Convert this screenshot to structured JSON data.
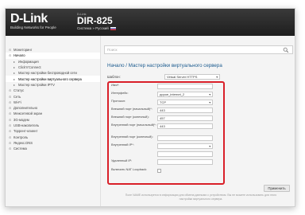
{
  "header": {
    "logo_main": "D-Link",
    "logo_sub": "Building Networks for People",
    "model_caption": "D-Link",
    "model_name": "DIR-825",
    "lang_text": "Система » Русский"
  },
  "sidebar": {
    "items": [
      {
        "label": "Мониторинг",
        "level": 0,
        "marker": "⊙",
        "active": false
      },
      {
        "label": "Начало",
        "level": 0,
        "marker": "⊙",
        "active": true
      },
      {
        "label": "Информация",
        "level": 1,
        "marker": "▸",
        "active": false
      },
      {
        "label": "Click'n'Connect",
        "level": 1,
        "marker": "▸",
        "active": false
      },
      {
        "label": "Мастер настройки беспроводной сети",
        "level": 1,
        "marker": "▸",
        "active": false
      },
      {
        "label": "Мастер настройки виртуального сервера",
        "level": 1,
        "marker": "▸",
        "active": true
      },
      {
        "label": "Мастер настройки IPTV",
        "level": 1,
        "marker": "▸",
        "active": false
      },
      {
        "label": "Статус",
        "level": 0,
        "marker": "⊙",
        "active": false
      },
      {
        "label": "Сеть",
        "level": 0,
        "marker": "⊙",
        "active": false
      },
      {
        "label": "Wi-Fi",
        "level": 0,
        "marker": "⊙",
        "active": false
      },
      {
        "label": "Дополнительно",
        "level": 0,
        "marker": "⊙",
        "active": false
      },
      {
        "label": "Межсетевой экран",
        "level": 0,
        "marker": "⊙",
        "active": false
      },
      {
        "label": "3G-модем",
        "level": 0,
        "marker": "⊙",
        "active": false
      },
      {
        "label": "USB-накопитель",
        "level": 0,
        "marker": "⊙",
        "active": false
      },
      {
        "label": "Торрент-клиент",
        "level": 0,
        "marker": "⊙",
        "active": false
      },
      {
        "label": "Контроль",
        "level": 0,
        "marker": "⊙",
        "active": false
      },
      {
        "label": "Яндекс.DNS",
        "level": 0,
        "marker": "⊙",
        "active": false
      },
      {
        "label": "Система",
        "level": 0,
        "marker": "⊙",
        "active": false
      }
    ]
  },
  "search": {
    "placeholder": "Поиск"
  },
  "page": {
    "title": "Начало  /  Мастер настройки виртуального сервера",
    "template_label": "Шаблон:",
    "template_value": "Virtual Server HTTPS"
  },
  "form": {
    "name_label": "Имя*:",
    "interface_label": "Интерфейс:",
    "interface_value": "pppoe_internet_2",
    "protocol_label": "Протокол:",
    "protocol_value": "TCP",
    "ext_port_start_label": "Внешний порт (начальный)*:",
    "ext_port_start_value": "443",
    "ext_port_end_label": "Внешний порт (конечный):",
    "ext_port_end_value": "457",
    "int_port_start_label": "Внутренний порт (начальный)*:",
    "int_port_start_value": "443",
    "int_port_end_label": "Внутренний порт (конечный):",
    "int_ip_label": "Внутренний IP*:",
    "remote_ip_label": "Удаленный IP:",
    "nat_loopback_label": "Включить NAT Loopback:"
  },
  "footnote": "Поле NAME используется в информации для обмена данными с устройством. Вы не можете использовать для этого настройки виртуального сервера.",
  "apply_button": "Применить"
}
